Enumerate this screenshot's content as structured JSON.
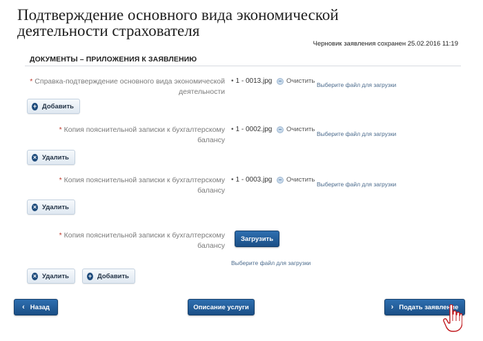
{
  "page": {
    "title": "Подтверждение основного вида экономической деятельности страхователя",
    "draft_notice": "Черновик заявления сохранен 25.02.2016 11:19",
    "section_title": "ДОКУМЕНТЫ – ПРИЛОЖЕНИЯ К ЗАЯВЛЕНИЮ"
  },
  "documents": [
    {
      "label_line1": "Справка-подтверждение основного вида экономической",
      "label_line2": "деятельности",
      "file": "1 - 0013.jpg",
      "clear": "Очистить",
      "choose": "Выберите файл для загрузки",
      "button": "Добавить"
    },
    {
      "label_line1": "Копия пояснительной записки к бухгалтерскому",
      "label_line2": "балансу",
      "file": "1 - 0002.jpg",
      "clear": "Очистить",
      "choose": "Выберите файл для загрузки",
      "button": "Удалить"
    },
    {
      "label_line1": "Копия пояснительной записки к бухгалтерскому",
      "label_line2": "балансу",
      "file": "1 - 0003.jpg",
      "clear": "Очистить",
      "choose": "Выберите файл для загрузки",
      "button": "Удалить"
    },
    {
      "label_line1": "Копия пояснительной записки к бухгалтерскому",
      "label_line2": "балансу",
      "upload": "Загрузить",
      "choose": "Выберите файл для загрузки",
      "button_remove": "Удалить",
      "button_add": "Добавить"
    }
  ],
  "footer": {
    "back": "Назад",
    "service_description": "Описание услуги",
    "submit": "Подать заявление"
  },
  "icons": {
    "plus": "plus-icon",
    "remove": "remove-icon",
    "clear": "clear-icon",
    "back": "chevron-left-icon",
    "submit": "chevron-right-icon",
    "cursor": "hand-cursor-icon"
  },
  "colors": {
    "primary_button": "#1f5a96",
    "required_star": "#c0392b",
    "link": "#4a6a8c"
  }
}
